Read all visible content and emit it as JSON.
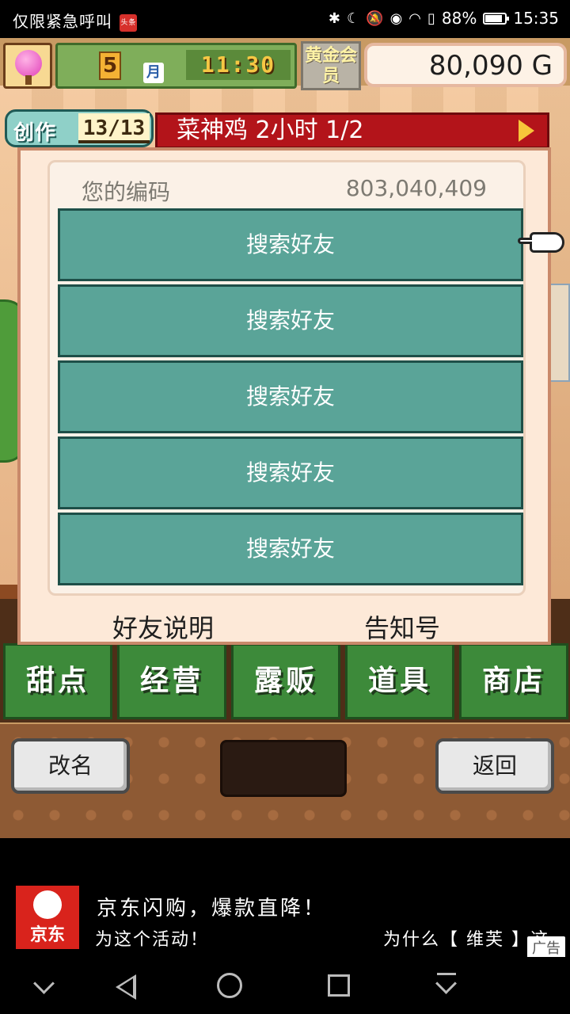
{
  "status_bar": {
    "left_text": "仅限紧急呼叫",
    "news_badge": "头条",
    "battery": "88%",
    "time": "15:35"
  },
  "hud": {
    "month": "5",
    "month_unit": "月",
    "time": "11:30",
    "gold_member": "黄金会员",
    "money": "80,090 G"
  },
  "create": {
    "label": "创作",
    "count": "13/13",
    "recipe": "菜神鸡  2小时 1/2"
  },
  "dialog": {
    "code_label": "您的编码",
    "code_value": "803,040,409",
    "friend_slots": [
      "搜索好友",
      "搜索好友",
      "搜索好友",
      "搜索好友",
      "搜索好友"
    ],
    "footer_left": "好友说明",
    "footer_right": "告知号"
  },
  "categories": [
    "甜点",
    "经营",
    "露贩",
    "道具",
    "商店"
  ],
  "bottom": {
    "rename": "改名",
    "back": "返回"
  },
  "ad": {
    "brand": "京东",
    "title": "京东闪购，爆款直降！",
    "sub_left": "为这个活动！",
    "sub_right": "为什么【 维芙 】这",
    "tag": "广告"
  }
}
